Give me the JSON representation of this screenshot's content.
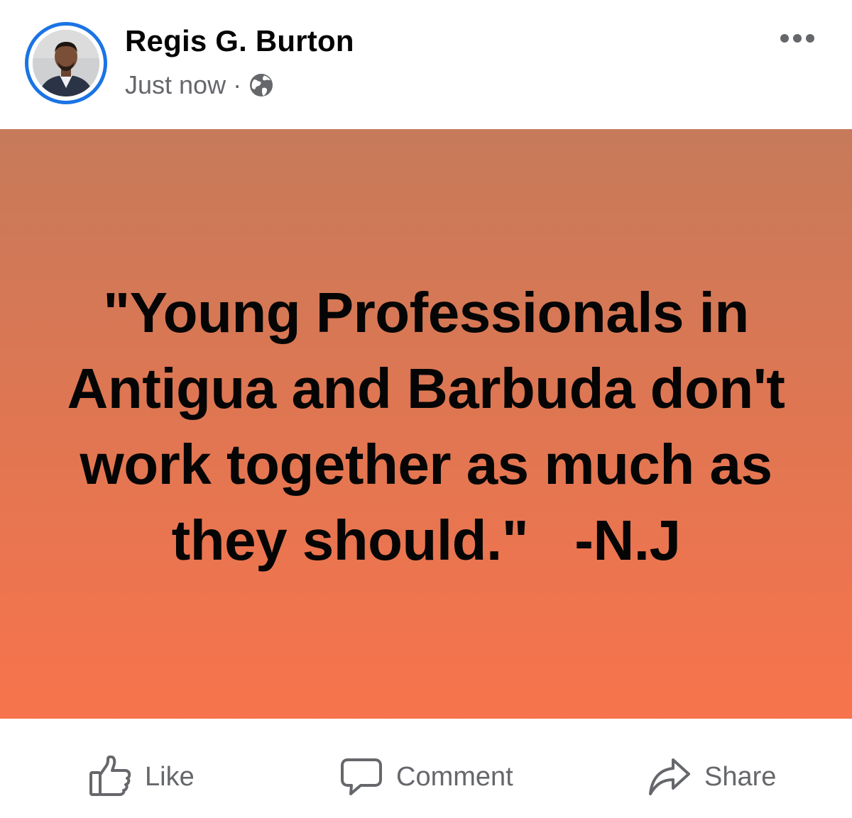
{
  "post": {
    "author": {
      "name": "Regis G. Burton",
      "avatar_icon": "profile-photo"
    },
    "timestamp": "Just now",
    "separator": "·",
    "privacy_icon": "globe-icon",
    "menu_icon": "more-horizontal-icon",
    "background_colors": [
      "#c67a5a",
      "#e07652",
      "#f7744c"
    ],
    "quote": "\"Young Professionals in Antigua and Barbuda don't work together as much as they should.\"   -N.J"
  },
  "actions": {
    "like": {
      "label": "Like",
      "icon": "thumbs-up-icon"
    },
    "comment": {
      "label": "Comment",
      "icon": "speech-bubble-icon"
    },
    "share": {
      "label": "Share",
      "icon": "share-arrow-icon"
    }
  },
  "colors": {
    "accent": "#1b74e4",
    "text_primary": "#050505",
    "text_secondary": "#65676b"
  }
}
